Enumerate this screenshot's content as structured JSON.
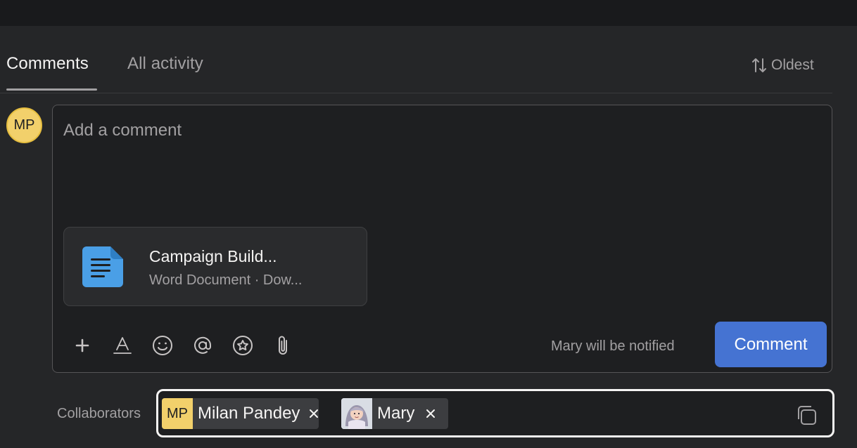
{
  "tabs": [
    {
      "label": "Comments",
      "active": true
    },
    {
      "label": "All activity",
      "active": false
    }
  ],
  "sort": {
    "label": "Oldest",
    "icon": "sort-arrows-icon"
  },
  "current_user": {
    "initials": "MP"
  },
  "composer": {
    "placeholder": "Add a comment",
    "attachment": {
      "title": "Campaign Build...",
      "subtitle": "Word Document · Dow...",
      "icon": "document-icon"
    },
    "toolbar": [
      {
        "name": "plus-icon"
      },
      {
        "name": "text-format-icon"
      },
      {
        "name": "emoji-icon"
      },
      {
        "name": "mention-icon"
      },
      {
        "name": "star-icon"
      },
      {
        "name": "paperclip-icon"
      }
    ],
    "notify_text": "Mary will be notified",
    "submit_label": "Comment"
  },
  "collaborators": {
    "label": "Collaborators",
    "people": [
      {
        "initials": "MP",
        "name": "Milan Pandey"
      },
      {
        "name": "Mary"
      }
    ]
  },
  "colors": {
    "accent": "#4573d2",
    "avatar_yellow": "#f2d06b",
    "background": "#252628"
  }
}
